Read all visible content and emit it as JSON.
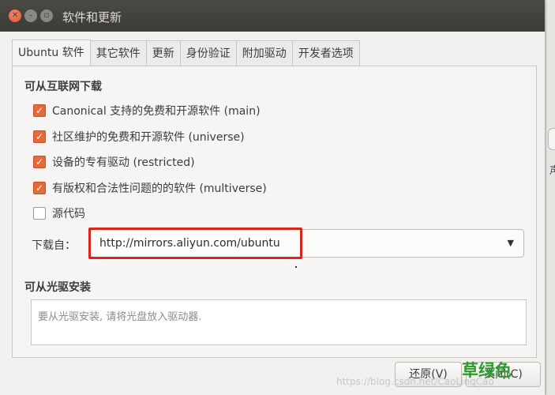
{
  "window": {
    "title": "软件和更新"
  },
  "tabs": [
    "Ubuntu 软件",
    "其它软件",
    "更新",
    "身份验证",
    "附加驱动",
    "开发者选项"
  ],
  "internet_section": {
    "title": "可从互联网下载",
    "items": [
      {
        "label": "Canonical 支持的免费和开源软件 (main)",
        "checked": true
      },
      {
        "label": "社区维护的免费和开源软件 (universe)",
        "checked": true
      },
      {
        "label": "设备的专有驱动 (restricted)",
        "checked": true
      },
      {
        "label": "有版权和合法性问题的的软件 (multiverse)",
        "checked": true
      },
      {
        "label": "源代码",
        "checked": false
      }
    ]
  },
  "download_from": {
    "label": "下载自：",
    "value": "http://mirrors.aliyun.com/ubuntu"
  },
  "cdrom_section": {
    "title": "可从光驱安装",
    "placeholder": "要从光驱安装, 请将光盘放入驱动器."
  },
  "buttons": {
    "revert": "还原(V)",
    "close": "关闭(C)"
  },
  "overlay": {
    "green_text": "草绿色",
    "watermark": "https://blog.csdn.net/CaoLinqCao"
  },
  "background_fragment": "声",
  "colors": {
    "checkbox_accent": "#e36b3b",
    "highlight_border": "#d7261e",
    "titlebar": "#3c3b37"
  }
}
